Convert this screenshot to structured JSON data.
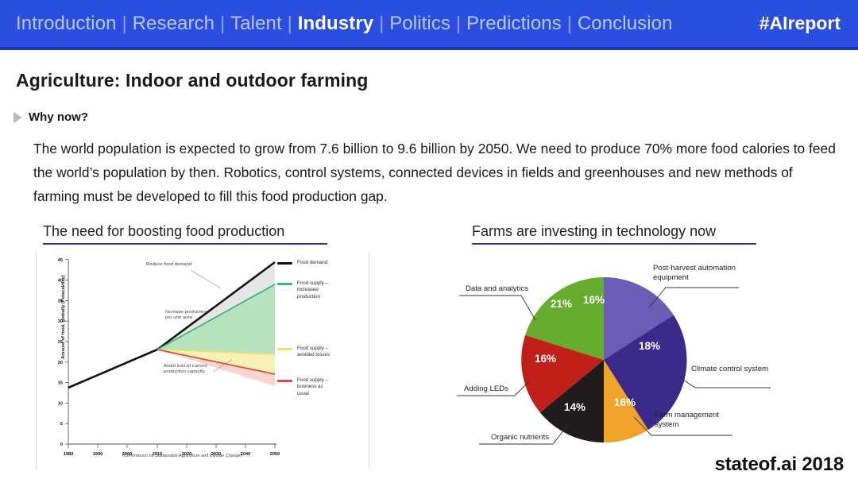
{
  "nav": {
    "items": [
      {
        "label": "Introduction",
        "active": false
      },
      {
        "label": "Research",
        "active": false
      },
      {
        "label": "Talent",
        "active": false
      },
      {
        "label": "Industry",
        "active": true
      },
      {
        "label": "Politics",
        "active": false
      },
      {
        "label": "Predictions",
        "active": false
      },
      {
        "label": "Conclusion",
        "active": false
      }
    ],
    "separator": "|",
    "hashtag": "#AIreport",
    "bar_color": "#2a4ee0"
  },
  "slide": {
    "title": "Agriculture: Indoor and outdoor farming",
    "bullet_label": "Why now?",
    "paragraph": "The world population is expected to grow from 7.6 billion to 9.6 billion by 2050. We need to produce 70% more food calories to feed the world’s population by then. Robotics, control systems, connected devices in fields and greenhouses and new methods of farming must be developed to fill this food production gap.",
    "footer_brand": "stateof.ai 2018"
  },
  "panels": {
    "left_heading": "The need for boosting food production",
    "right_heading": "Farms are investing in technology now",
    "rule_color": "#3b3f9e"
  },
  "chart_data": [
    {
      "type": "line",
      "title": "The need for boosting food production",
      "xlabel": "",
      "ylabel": "Amount of food, globally (Petacal/day)",
      "source": "(Commission on Sustainable Agriculture and Climate Change)",
      "xlim": [
        1980,
        2050
      ],
      "ylim": [
        0,
        45
      ],
      "xticks": [
        "1980",
        "1990",
        "2000",
        "2010",
        "2020",
        "2030",
        "2040",
        "2050"
      ],
      "yticks": [
        "0",
        "5",
        "10",
        "15",
        "20",
        "25",
        "30",
        "35",
        "40",
        "45"
      ],
      "grid": false,
      "legend_position": "right",
      "annotations": [
        "Reduce food demand",
        "Increase production\nper unit area",
        "Avoid loss of current\nproduction capacity"
      ],
      "series": [
        {
          "name": "Food demand",
          "color": "#111111",
          "x": [
            1980,
            2010,
            2050
          ],
          "values": [
            13.8,
            24.8,
            42.0
          ]
        },
        {
          "name": "Food supply –\nincreased\nproduction",
          "color": "#2fb67c",
          "x": [
            1980,
            2010,
            2050
          ],
          "values": [
            13.8,
            24.8,
            36.5
          ]
        },
        {
          "name": "Food supply –\navoided losses",
          "color": "#e9e56a",
          "x": [
            1980,
            2010,
            2050
          ],
          "values": [
            13.8,
            24.8,
            24.6
          ]
        },
        {
          "name": "Food supply –\nbusiness as\nusual",
          "color": "#e0483c",
          "x": [
            1980,
            2010,
            2050
          ],
          "values": [
            13.8,
            24.8,
            19.6
          ]
        }
      ]
    },
    {
      "type": "pie",
      "title": "Farms are investing in technology now",
      "legend_position": "callouts",
      "categories": [
        "Post-harvest automation\nequipment",
        "Climate control system",
        "Farm management\nsystem",
        "Organic nutrients",
        "Adding LEDs",
        "Data and analytics"
      ],
      "values": [
        16,
        18,
        16,
        14,
        16,
        21
      ],
      "value_labels": [
        "16%",
        "18%",
        "16%",
        "14%",
        "16%",
        "21%"
      ],
      "colors": [
        "#6c5cb5",
        "#3b2a8c",
        "#f0a32a",
        "#201c1c",
        "#c1201a",
        "#66ac2e"
      ]
    }
  ]
}
